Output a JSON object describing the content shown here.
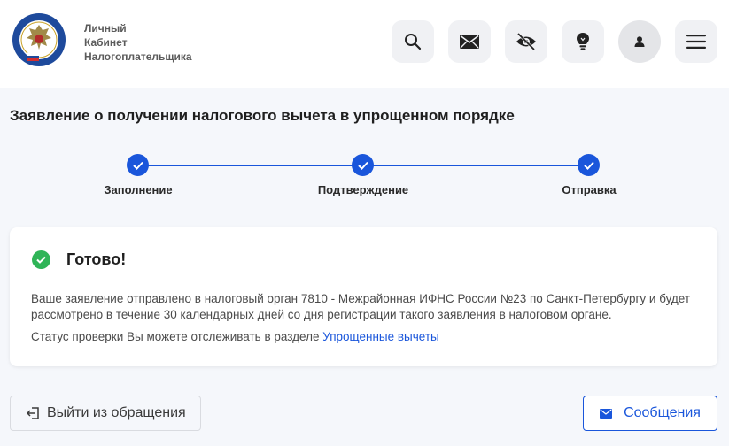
{
  "header": {
    "logo_lines": [
      "Личный",
      "Кабинет",
      "Налогоплательщика"
    ],
    "icons": [
      "search-icon",
      "mail-icon",
      "eye-off-icon",
      "lightbulb-icon",
      "user-icon",
      "menu-icon"
    ]
  },
  "page": {
    "title": "Заявление о получении налогового вычета в упрощенном порядке"
  },
  "stepper": {
    "steps": [
      {
        "label": "Заполнение",
        "state": "done"
      },
      {
        "label": "Подтверждение",
        "state": "done"
      },
      {
        "label": "Отправка",
        "state": "done"
      }
    ]
  },
  "result": {
    "title": "Готово!",
    "message": "Ваше заявление отправлено в налоговый орган 7810 - Межрайонная ИФНС России №23 по Санкт-Петербургу и будет рассмотрено в течение 30 календарных дней со дня регистрации такого заявления в налоговом органе.",
    "status_prefix": "Статус проверки Вы можете отслеживать в разделе",
    "status_link": "Упрощенные вычеты"
  },
  "actions": {
    "exit_label": "Выйти из обращения",
    "messages_label": "Сообщения"
  },
  "colors": {
    "accent": "#1a56db",
    "success": "#2fb457",
    "background": "#f5f7fb"
  }
}
